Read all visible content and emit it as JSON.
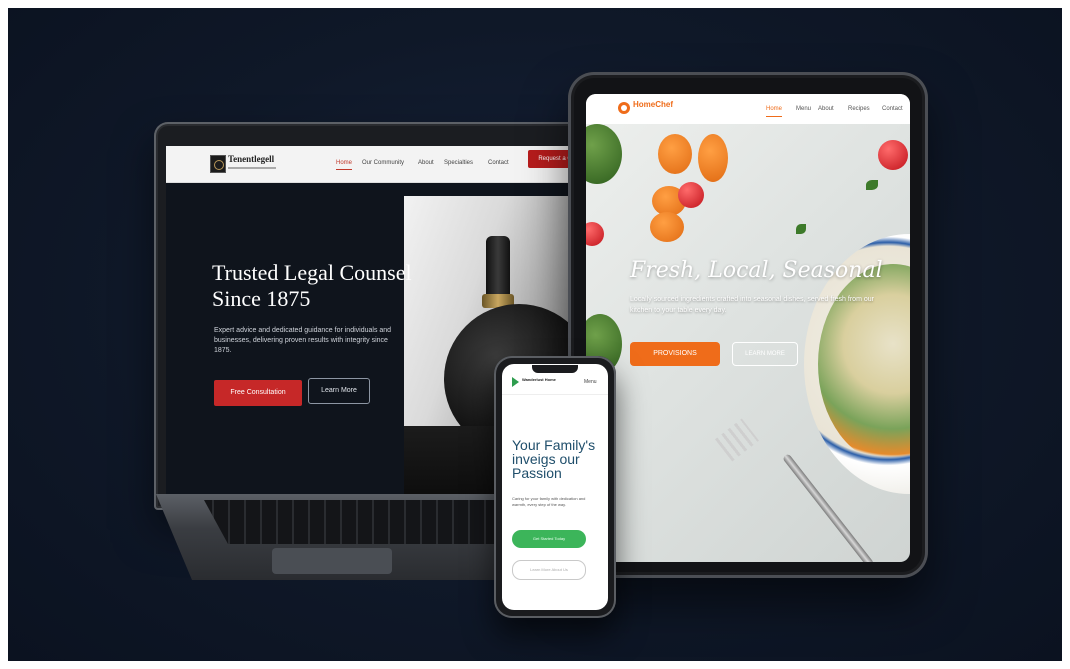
{
  "laptop": {
    "brand": "Tenentlegell",
    "nav": [
      "Home",
      "Our Community",
      "About",
      "Specialties",
      "Contact"
    ],
    "nav_cta": "Request a Call",
    "hero_title": "Trusted Legal Counsel Since 1875",
    "hero_desc": "Expert advice and dedicated guidance for individuals and businesses, delivering proven results with integrity since 1875.",
    "primary_cta": "Free Consultation",
    "secondary_cta": "Learn More"
  },
  "tablet": {
    "brand": "HomeChef",
    "nav": [
      "Home",
      "Menu",
      "About",
      "Recipes",
      "Contact"
    ],
    "hero_title": "Fresh, Local, Seasonal",
    "hero_desc": "Locally sourced ingredients crafted into seasonal dishes, served fresh from our kitchen to your table every day.",
    "primary_cta": "PROVISIONS",
    "secondary_cta": "LEARN MORE"
  },
  "phone": {
    "brand": "Wanderlust Home",
    "menu": "Menu",
    "hero_title": "Your Family's inveigs our Passion",
    "hero_desc": "Caring for your family with dedication and warmth, every step of the way.",
    "primary_cta": "Get Started Today",
    "secondary_cta": "Learn More About Us"
  },
  "colors": {
    "law_accent": "#c62828",
    "food_accent": "#ef6c1a",
    "app_accent": "#3cb55a",
    "background": "#0f1828"
  }
}
